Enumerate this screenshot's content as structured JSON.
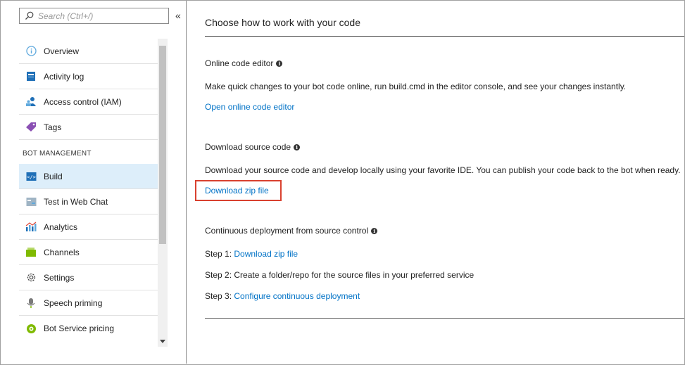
{
  "search": {
    "placeholder": "Search (Ctrl+/)"
  },
  "sidebar": {
    "collapse_glyph": "«",
    "items_top": [
      {
        "label": "Overview",
        "icon": "overview-icon"
      },
      {
        "label": "Activity log",
        "icon": "activity-log-icon"
      },
      {
        "label": "Access control (IAM)",
        "icon": "iam-icon"
      },
      {
        "label": "Tags",
        "icon": "tag-icon"
      }
    ],
    "section_title": "BOT MANAGEMENT",
    "items_bot": [
      {
        "label": "Build",
        "icon": "code-icon",
        "active": true
      },
      {
        "label": "Test in Web Chat",
        "icon": "webchat-icon"
      },
      {
        "label": "Analytics",
        "icon": "analytics-icon"
      },
      {
        "label": "Channels",
        "icon": "channels-icon"
      },
      {
        "label": "Settings",
        "icon": "gear-icon"
      },
      {
        "label": "Speech priming",
        "icon": "microphone-icon"
      },
      {
        "label": "Bot Service pricing",
        "icon": "pricing-icon"
      }
    ]
  },
  "main": {
    "title": "Choose how to work with your code",
    "online_editor": {
      "title": "Online code editor",
      "description": "Make quick changes to your bot code online, run build.cmd in the editor console, and see your changes instantly.",
      "link": "Open online code editor"
    },
    "download": {
      "title": "Download source code",
      "description": "Download your source code and develop locally using your favorite IDE. You can publish your code back to the bot when ready.",
      "link": "Download zip file"
    },
    "continuous": {
      "title": "Continuous deployment from source control",
      "step1_prefix": "Step 1: ",
      "step1_link": "Download zip file",
      "step2": "Step 2: Create a folder/repo for the source files in your preferred service",
      "step3_prefix": "Step 3: ",
      "step3_link": "Configure continuous deployment"
    },
    "info_glyph": "i"
  },
  "colors": {
    "link": "#0072c6",
    "active_bg": "#ddeefa",
    "highlight": "#d9412f"
  }
}
